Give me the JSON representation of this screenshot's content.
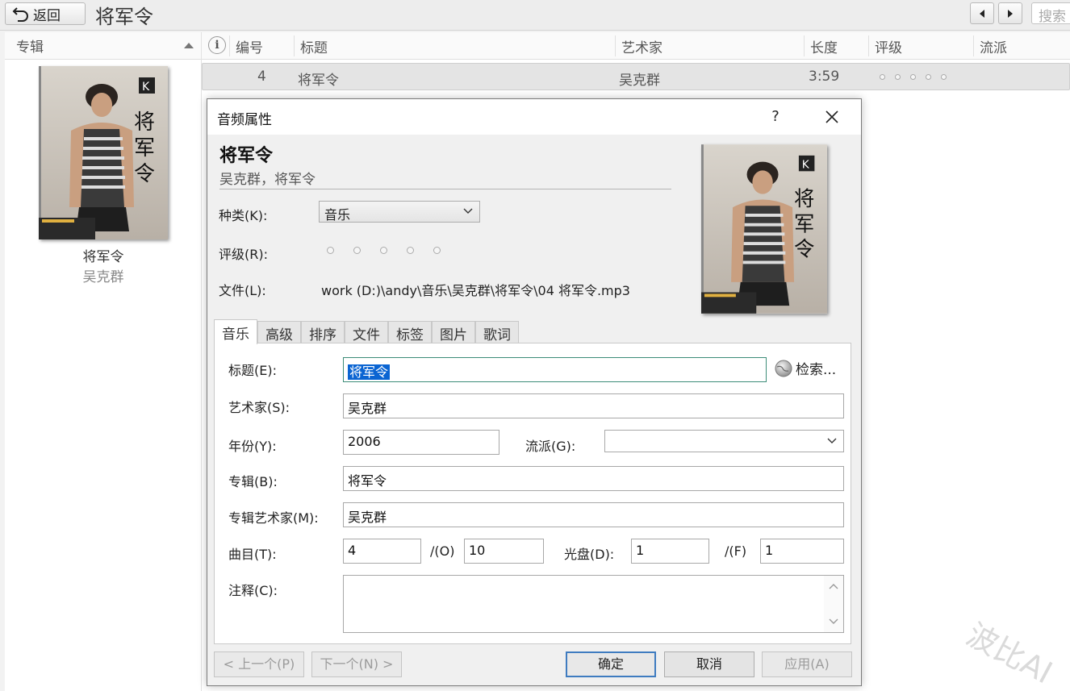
{
  "topbar": {
    "back_label": "返回",
    "title": "将军令",
    "search_placeholder": "搜索"
  },
  "left_pane": {
    "header": "专辑",
    "album": {
      "name": "将军令",
      "artist": "吴克群"
    }
  },
  "track_list": {
    "columns": [
      "编号",
      "标题",
      "艺术家",
      "长度",
      "评级",
      "流派"
    ],
    "rows": [
      {
        "number": "4",
        "title": "将军令",
        "artist": "吴克群",
        "length": "3:59",
        "rating": 0,
        "genre": ""
      }
    ]
  },
  "dialog": {
    "title": "音频属性",
    "help": "?",
    "header_title": "将军令",
    "header_subtitle": "吴克群，将军令",
    "kind_label": "种类(K):",
    "kind_value": "音乐",
    "rating_label": "评级(R):",
    "rating_value": 0,
    "file_label": "文件(L):",
    "file_path": "work (D:)\\andy\\音乐\\吴克群\\将军令\\04 将军令.mp3",
    "tabs": [
      "音乐",
      "高级",
      "排序",
      "文件",
      "标签",
      "图片",
      "歌词"
    ],
    "active_tab": "音乐",
    "fields": {
      "title_label": "标题(E):",
      "title_value": "将军令",
      "search_label": "检索...",
      "artist_label": "艺术家(S):",
      "artist_value": "吴克群",
      "year_label": "年份(Y):",
      "year_value": "2006",
      "genre_label": "流派(G):",
      "genre_value": "",
      "album_label": "专辑(B):",
      "album_value": "将军令",
      "album_artist_label": "专辑艺术家(M):",
      "album_artist_value": "吴克群",
      "track_label": "曲目(T):",
      "track_value": "4",
      "track_of_label": "/(O)",
      "track_of_value": "10",
      "disc_label": "光盘(D):",
      "disc_value": "1",
      "disc_of_label": "/(F)",
      "disc_of_value": "1",
      "comment_label": "注释(C):",
      "comment_value": ""
    },
    "buttons": {
      "prev": "< 上一个(P)",
      "next": "下一个(N) >",
      "ok": "确定",
      "cancel": "取消",
      "apply": "应用(A)"
    }
  },
  "watermark": "波比AI",
  "colors": {
    "selection": "#0a64d2",
    "focus_border": "#3c8c78",
    "default_button_border": "#3f7cc0"
  }
}
